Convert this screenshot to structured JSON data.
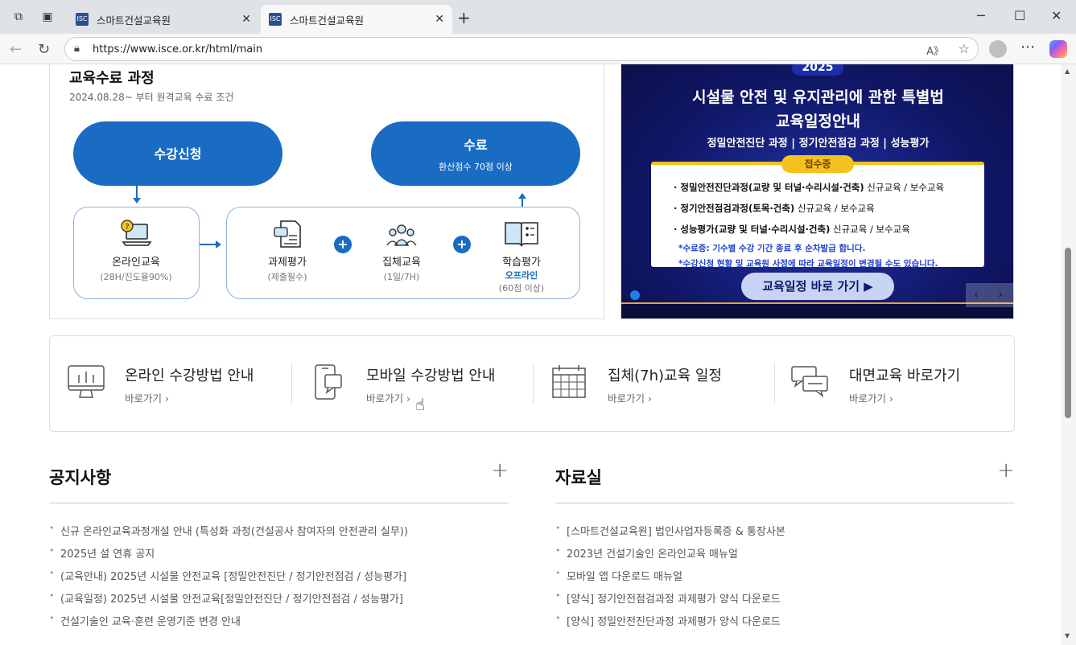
{
  "browser": {
    "tabs": [
      {
        "title": "스마트건설교육원",
        "active": false
      },
      {
        "title": "스마트건설교육원",
        "active": true
      }
    ],
    "url": "https://www.isce.or.kr/html/main",
    "new_tab": "+",
    "window_controls": {
      "minimize": "─",
      "maximize": "☐",
      "close": "✕"
    }
  },
  "course": {
    "title": "교육수료 과정",
    "subtitle": "2024.08.28~ 부터 원격교육 수료 조건",
    "apply": "수강신청",
    "complete": "수료",
    "complete_sub": "환산점수 70점 이상",
    "steps": [
      {
        "label": "온라인교육",
        "sub": "(28H/진도율90%)",
        "icon": "laptop-question-icon"
      },
      {
        "label": "과제평가",
        "sub": "(제출필수)",
        "icon": "document-chat-icon"
      },
      {
        "label": "집체교육",
        "sub": "(1일/7H)",
        "icon": "group-people-icon"
      },
      {
        "label": "학습평가",
        "sub_accent": "오프라인",
        "sub": "(60점 이상)",
        "icon": "open-book-icon"
      }
    ]
  },
  "banner": {
    "year": "2025",
    "title1": "시설물 안전 및 유지관리에 관한 특별법",
    "title2": "교육일정안내",
    "subtitle": "정밀안전진단 과정 | 정기안전점검 과정 | 성능평가",
    "tag": "접수중",
    "lines": [
      {
        "bold": "· 정밀안전진단과정(교량 및 터널·수리시설·건축)",
        "rest": " 신규교육 / 보수교육"
      },
      {
        "bold": "· 정기안전점검과정(토목·건축)",
        "rest": " 신규교육 / 보수교육"
      },
      {
        "bold": "· 성능평가(교량 및 터널·수리시설·건축)",
        "rest": " 신규교육 / 보수교육"
      }
    ],
    "notes": [
      "*수료증: 기수별 수강 기간 종료 후 순차발급 합니다.",
      "*수강신청 현황 및 교육원 사정에 따라 교육일정이 변경될 수도 있습니다."
    ],
    "button": "교육일정 바로 가기 ▶",
    "prev": "‹",
    "next": "›"
  },
  "quick_links": [
    {
      "title": "온라인 수강방법 안내",
      "link": "바로가기 ›",
      "icon": "monitor-icon"
    },
    {
      "title": "모바일 수강방법 안내",
      "link": "바로가기 ›",
      "icon": "mobile-icon"
    },
    {
      "title": "집체(7h)교육 일정",
      "link": "바로가기 ›",
      "icon": "calendar-icon"
    },
    {
      "title": "대면교육 바로가기",
      "link": "바로가기 ›",
      "icon": "chat-bubbles-icon"
    }
  ],
  "notice": {
    "title": "공지사항",
    "items": [
      "신규 온라인교육과정개설 안내 (특성화 과정(건설공사 참여자의 안전관리 실무))",
      "2025년 설 연휴 공지",
      "(교육안내) 2025년 시설물 안전교육 [정밀안전진단 / 정기안전점검 / 성능평가]",
      "(교육일정) 2025년 시설물 안전교육[정밀안전진단 / 정기안전점검 / 성능평가]",
      "건설기술인 교육·훈련 운영기준 변경 안내"
    ]
  },
  "archive": {
    "title": "자료실",
    "items": [
      "[스마트건설교육원] 법인사업자등록증 & 통장사본",
      "2023년 건설기술인 온라인교육 매뉴얼",
      "모바일 앱 다운로드 매뉴얼",
      "[양식] 정기안전점검과정 과제평가 양식 다운로드",
      "[양식] 정밀안전진단과정 과제평가 양식 다운로드"
    ]
  },
  "colors": {
    "primary": "#1a6cc3",
    "banner_bg": "#101766",
    "accent_yellow": "#f4c21e"
  }
}
